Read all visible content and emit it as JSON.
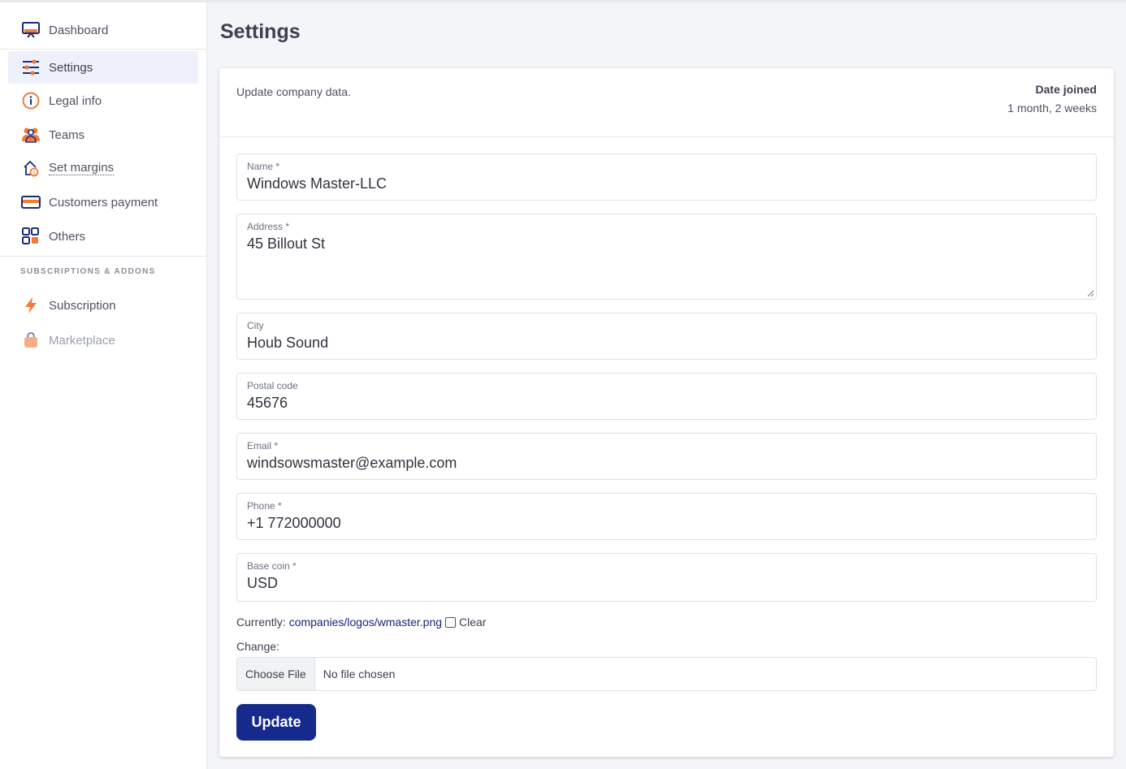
{
  "sidebar": {
    "items": [
      {
        "label": "Dashboard",
        "icon": "monitor-icon"
      },
      {
        "label": "Settings",
        "icon": "sliders-icon"
      },
      {
        "label": "Legal info",
        "icon": "info-icon"
      },
      {
        "label": "Teams",
        "icon": "users-icon"
      },
      {
        "label": "Set margins",
        "icon": "house-tag-icon"
      },
      {
        "label": "Customers payment",
        "icon": "credit-card-icon"
      },
      {
        "label": "Others",
        "icon": "grid-icon"
      }
    ],
    "section_label": "Subscriptions & Addons",
    "section_items": [
      {
        "label": "Subscription",
        "icon": "lightning-icon"
      },
      {
        "label": "Marketplace",
        "icon": "shopping-bag-icon"
      }
    ]
  },
  "page": {
    "title": "Settings"
  },
  "card": {
    "subtitle": "Update company data.",
    "date_joined_label": "Date joined",
    "date_joined_value": "1 month, 2 weeks"
  },
  "form": {
    "name_label": "Name *",
    "name_value": "Windows Master-LLC",
    "address_label": "Address *",
    "address_value": "45 Billout St",
    "city_label": "City",
    "city_value": "Houb Sound",
    "postal_label": "Postal code",
    "postal_value": "45676",
    "email_label": "Email *",
    "email_value": "windsowsmaster@example.com",
    "phone_label": "Phone *",
    "phone_value": "+1 772000000",
    "coin_label": "Base coin *",
    "coin_value": "USD",
    "currently_label": "Currently:",
    "currently_link": "companies/logos/wmaster.png",
    "clear_label": "Clear",
    "change_label": "Change:",
    "file_button": "Choose File",
    "file_status": "No file chosen",
    "update_button": "Update"
  },
  "colors": {
    "accent": "#152a8c",
    "icon_orange": "#f07a3a",
    "icon_navy": "#1c2b7a"
  }
}
